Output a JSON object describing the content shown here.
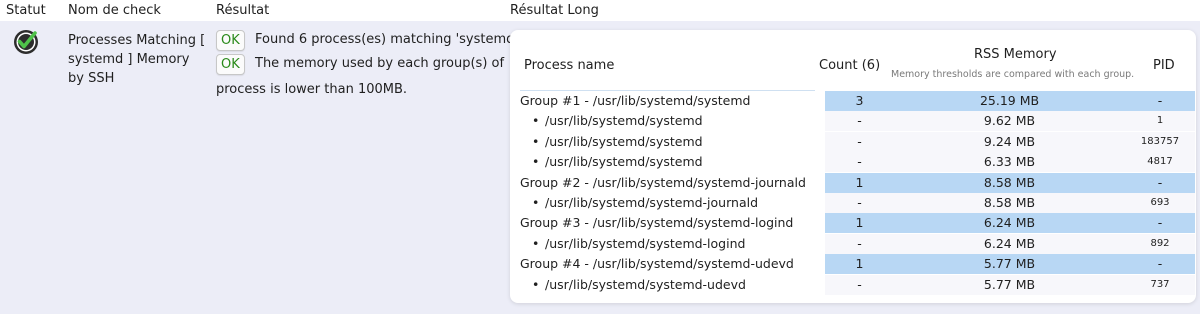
{
  "header": {
    "statut": "Statut",
    "nom": "Nom de check",
    "resultat": "Résultat",
    "resultat_long": "Résultat Long"
  },
  "check": {
    "status": "ok",
    "status_icon": "check-circle-icon",
    "name": "Processes Matching [ systemd ] Memory by SSH",
    "results": [
      {
        "badge": "OK",
        "text": "Found 6 process(es) matching 'systemd'."
      },
      {
        "badge": "OK",
        "text": "The memory used by each group(s) of",
        "cont": "process is lower than 100MB."
      }
    ]
  },
  "table": {
    "headers": {
      "name": "Process name",
      "count": "Count (6)",
      "mem": "RSS Memory",
      "mem_note": "Memory thresholds are compared with each group.",
      "pid": "PID"
    },
    "rows": [
      {
        "type": "group",
        "name": "Group #1 - /usr/lib/systemd/systemd",
        "count": "3",
        "mem": "25.19 MB",
        "pid": "-"
      },
      {
        "type": "child",
        "name": "/usr/lib/systemd/systemd",
        "count": "-",
        "mem": "9.62 MB",
        "pid": "1"
      },
      {
        "type": "child",
        "name": "/usr/lib/systemd/systemd",
        "count": "-",
        "mem": "9.24 MB",
        "pid": "183757"
      },
      {
        "type": "child",
        "name": "/usr/lib/systemd/systemd",
        "count": "-",
        "mem": "6.33 MB",
        "pid": "4817"
      },
      {
        "type": "group",
        "name": "Group #2 - /usr/lib/systemd/systemd-journald",
        "count": "1",
        "mem": "8.58 MB",
        "pid": "-"
      },
      {
        "type": "child",
        "name": "/usr/lib/systemd/systemd-journald",
        "count": "-",
        "mem": "8.58 MB",
        "pid": "693"
      },
      {
        "type": "group",
        "name": "Group #3 - /usr/lib/systemd/systemd-logind",
        "count": "1",
        "mem": "6.24 MB",
        "pid": "-"
      },
      {
        "type": "child",
        "name": "/usr/lib/systemd/systemd-logind",
        "count": "-",
        "mem": "6.24 MB",
        "pid": "892"
      },
      {
        "type": "group",
        "name": "Group #4 - /usr/lib/systemd/systemd-udevd",
        "count": "1",
        "mem": "5.77 MB",
        "pid": "-"
      },
      {
        "type": "child",
        "name": "/usr/lib/systemd/systemd-udevd",
        "count": "-",
        "mem": "5.77 MB",
        "pid": "737"
      }
    ]
  },
  "colors": {
    "row_bg": "#ecedf7",
    "highlight": "#b8d7f4",
    "ok_green": "#2a8a1a"
  }
}
